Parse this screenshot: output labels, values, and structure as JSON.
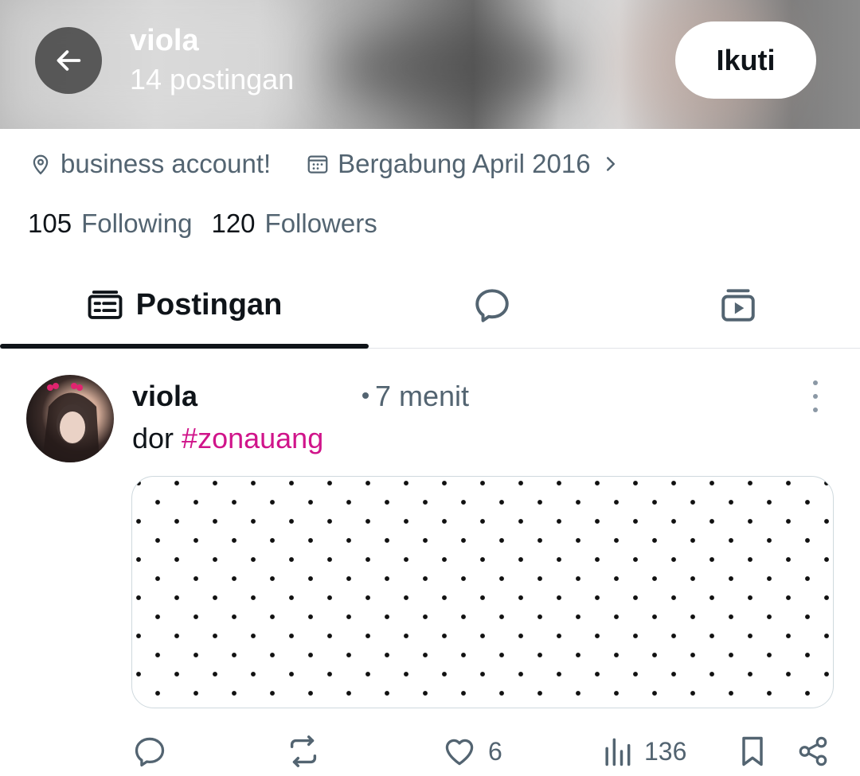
{
  "header": {
    "name": "viola",
    "post_count": "14 postingan",
    "follow_label": "Ikuti"
  },
  "profile": {
    "location": "business account!",
    "joined": "Bergabung April 2016",
    "following_count": "105",
    "following_label": "Following",
    "followers_count": "120",
    "followers_label": "Followers"
  },
  "tabs": [
    {
      "label": "Postingan",
      "icon": "posts-icon",
      "active": true
    },
    {
      "label": "",
      "icon": "replies-icon",
      "active": false
    },
    {
      "label": "",
      "icon": "media-icon",
      "active": false
    }
  ],
  "post": {
    "author": "viola",
    "time": "7 menit",
    "text": "dor",
    "hashtag": "#zonauang",
    "likes": "6",
    "views": "136"
  },
  "colors": {
    "text_primary": "#0f1419",
    "text_secondary": "#536471",
    "hashtag": "#d0148a",
    "tab_indicator": "#0f1419"
  }
}
